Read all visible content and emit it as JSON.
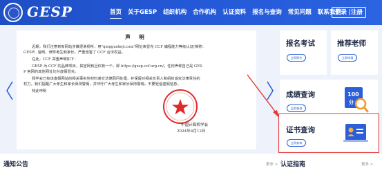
{
  "header": {
    "logo_text": "GESP",
    "nav": [
      "首页",
      "关于GESP",
      "组织机构",
      "合作机构",
      "认证资料",
      "报名与查询",
      "常见问题",
      "联系我们"
    ],
    "login_label": "登录 |注册"
  },
  "notice": {
    "title": "声 明",
    "paragraphs": [
      [
        "近期，我们注意到有网站涉嫌混淆视听，用\"qingguokeji.com\"网址来冒充 CCF 编程能力等级认证(简称：",
        "GESP）官网，误导考生和家长，严重侵害了 CCF 合法权益。"
      ],
      [
        "在此，CCF 郑重声明如下："
      ],
      [
        "GESP 为 CCF 的品牌项目，其官网有且仅有一个，即 https://gesp.ccf.org.cn/。任何声称自己是 GES",
        "P 官网的其他网址均为虚假冒充。"
      ],
      [
        "我学会已有该虚假网站的相关事实性材料递交法律顾问处理，并保留对相关负责人和组织追究法律责任的",
        "权力。我们提醒广大考生和家长保持警惕，并呼吁广大考生和家长保持警惕，不要轻信虚假信息。"
      ],
      [
        "特此申明"
      ]
    ],
    "signature_org": "中国计算机学会",
    "signature_date": "2024年4月12日"
  },
  "cards": {
    "register": {
      "title": "报名考试",
      "button": "立即报名"
    },
    "teacher": {
      "title": "推荐老师",
      "button": "立即申请"
    },
    "score": {
      "title": "成绩查询",
      "button": "立即查询",
      "icon_text": "100分"
    },
    "certificate": {
      "title": "证书查询",
      "button": "立即查询"
    }
  },
  "bottom": {
    "notice_title": "通知公告",
    "notice_more": "更多 >",
    "guide_title": "认证指南",
    "guide_more": "更多 >"
  },
  "colors": {
    "brand_blue": "#2459d8",
    "highlight_red": "#e53935",
    "band_bg": "#edf2fb"
  },
  "icons": {
    "logo": "ccf-seal-logo",
    "prev": "chevron-left-icon",
    "next": "chevron-right-icon",
    "score": "score-magnifier-icon",
    "certificate": "certificate-id-card-icon",
    "stamp": "red-official-stamp"
  }
}
